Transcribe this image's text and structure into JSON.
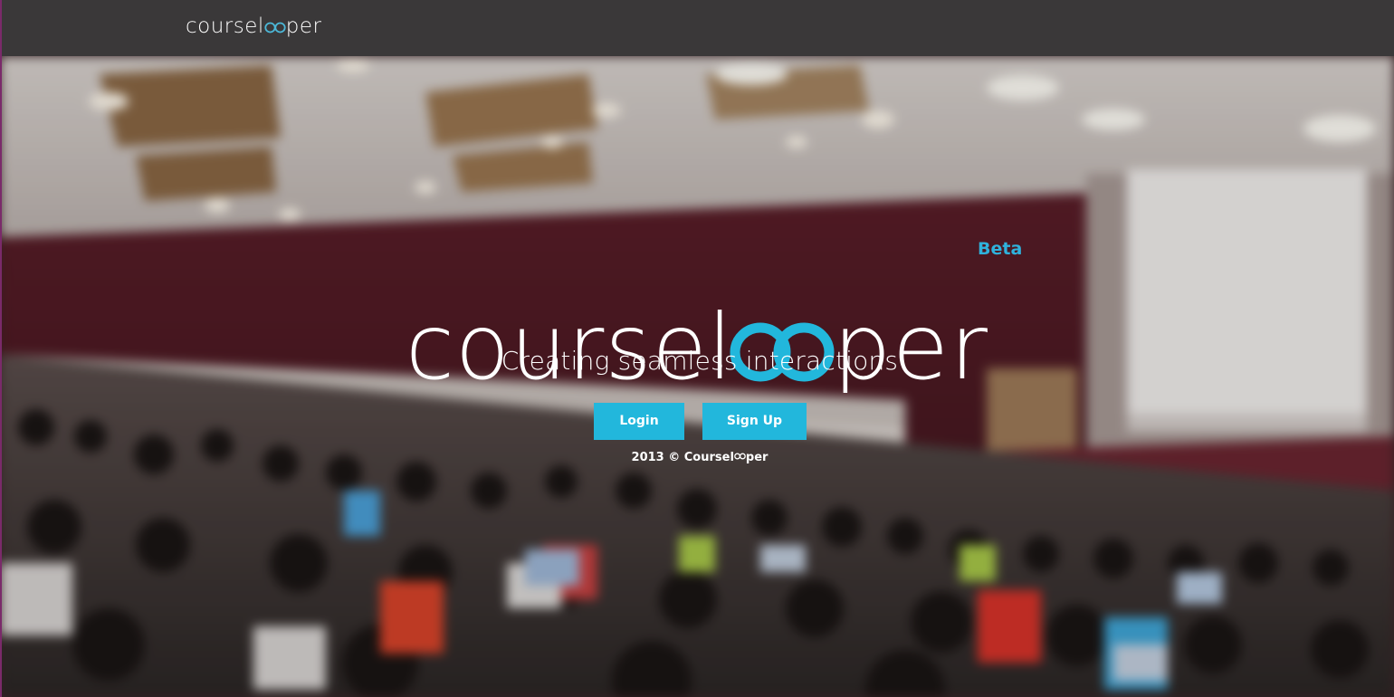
{
  "navbar": {
    "logo_prefix": "coursel",
    "logo_suffix": "per"
  },
  "hero": {
    "logo_text_prefix": "coursel",
    "logo_text_suffix": "per",
    "beta_label": "Beta",
    "tagline": "Creating seamless interactions",
    "login_label": "Login",
    "signup_label": "Sign Up",
    "copyright_prefix": "2013 © Coursel",
    "copyright_suffix": "per"
  },
  "colors": {
    "accent": "#22b7dc",
    "navbar_bg": "#3a3839",
    "text": "#ffffff"
  }
}
